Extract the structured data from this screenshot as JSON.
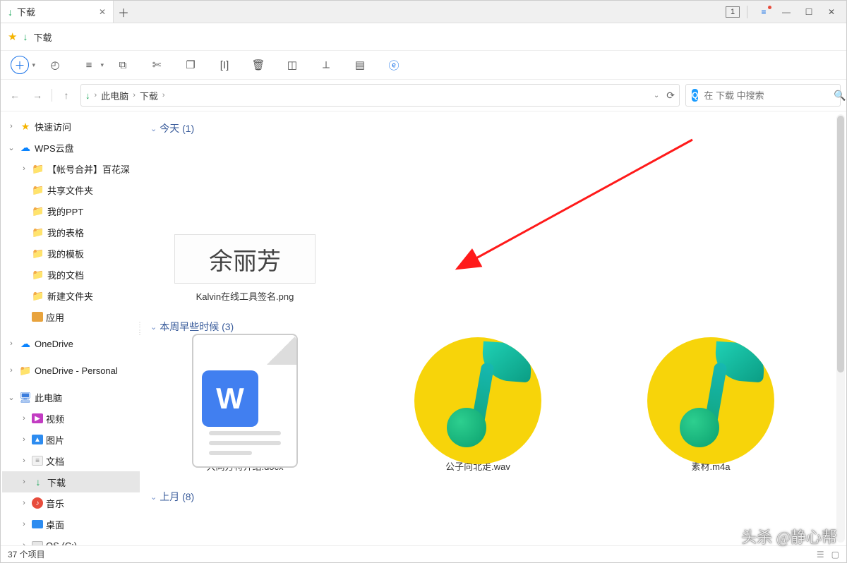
{
  "tab": {
    "title": "下载"
  },
  "window_controls": {
    "badge": "1"
  },
  "favorite": {
    "label": "下载"
  },
  "breadcrumb": {
    "root": "此电脑",
    "current": "下载"
  },
  "search": {
    "placeholder": "在 下载 中搜索"
  },
  "groups": {
    "today": {
      "label": "今天 (1)"
    },
    "week": {
      "label": "本周早些时候 (3)"
    },
    "lastmonth": {
      "label": "上月 (8)"
    }
  },
  "files": {
    "signature": {
      "name": "Kalvin在线工具签名.png",
      "handwriting": "余丽芳"
    },
    "docx": {
      "name": "大同方特介绍.docx"
    },
    "wav": {
      "name": "公子向北走.wav"
    },
    "m4a": {
      "name": "素材.m4a"
    }
  },
  "sidebar": {
    "quick": "快速访问",
    "wps": "WPS云盘",
    "wps_children": {
      "merge": "【帐号合并】百花深",
      "share": "共享文件夹",
      "ppt": "我的PPT",
      "table": "我的表格",
      "tmpl": "我的模板",
      "docs": "我的文档",
      "newdir": "新建文件夹",
      "apps": "应用"
    },
    "onedrive": "OneDrive",
    "onedrive_p": "OneDrive - Personal",
    "pc": "此电脑",
    "pc_children": {
      "video": "视频",
      "pic": "图片",
      "doc": "文档",
      "dl": "下载",
      "music": "音乐",
      "desk": "桌面",
      "os": "OS (C:)"
    }
  },
  "status": {
    "count": "37 个项目"
  },
  "watermark": "头杀 @静心帮"
}
